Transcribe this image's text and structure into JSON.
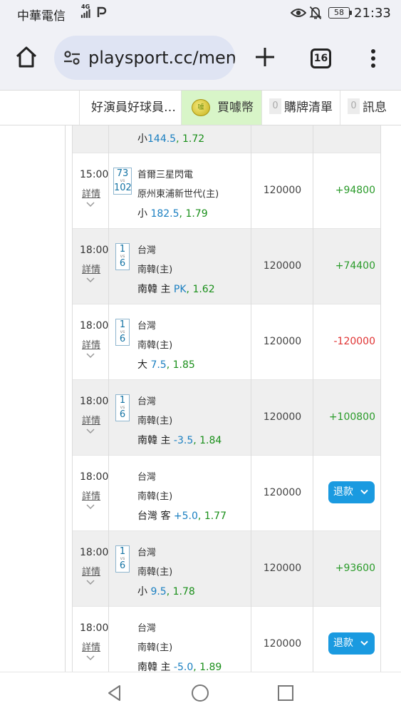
{
  "status_bar": {
    "carrier": "中華電信",
    "network": "4G",
    "battery": "58",
    "time": "21:33"
  },
  "browser": {
    "url": "playsport.cc/men",
    "tab_count": "16",
    "icons": [
      "home-icon",
      "site-info-icon",
      "new-tab-icon",
      "tabs-icon",
      "more-menu-icon"
    ]
  },
  "site_nav": {
    "player": "好演員好球員…",
    "coins": "買噱幣",
    "cart_count": "0",
    "cart": "購牌清單",
    "msg_count": "0",
    "msg": "訊息"
  },
  "top_partial": {
    "pick": "小",
    "line": "144.5",
    "odds": "1.72"
  },
  "bets": [
    {
      "time": "15:00",
      "detail": "詳情",
      "score_away": "73",
      "vs": "vs",
      "score_home": "102",
      "team1": "首爾三星閃電",
      "team2": "原州東浦新世代(主)",
      "pick": "小",
      "line": "182.5",
      "odds": "1.79",
      "amount": "120000",
      "result": "+94800",
      "result_type": "win"
    },
    {
      "time": "18:00",
      "detail": "詳情",
      "score_away": "1",
      "vs": "vs",
      "score_home": "6",
      "team1": "台灣",
      "team2": "南韓(主)",
      "pick": "南韓 主",
      "line": "PK",
      "odds": "1.62",
      "amount": "120000",
      "result": "+74400",
      "result_type": "win"
    },
    {
      "time": "18:00",
      "detail": "詳情",
      "score_away": "1",
      "vs": "vs",
      "score_home": "6",
      "team1": "台灣",
      "team2": "南韓(主)",
      "pick": "大",
      "line": "7.5",
      "odds": "1.85",
      "amount": "120000",
      "result": "-120000",
      "result_type": "lose"
    },
    {
      "time": "18:00",
      "detail": "詳情",
      "score_away": "1",
      "vs": "vs",
      "score_home": "6",
      "team1": "台灣",
      "team2": "南韓(主)",
      "pick": "南韓 主",
      "line": "-3.5",
      "odds": "1.84",
      "amount": "120000",
      "result": "+100800",
      "result_type": "win"
    },
    {
      "time": "18:00",
      "detail": "詳情",
      "team1": "台灣",
      "team2": "南韓(主)",
      "pick": "台灣 客",
      "line": "+5.0",
      "odds": "1.77",
      "amount": "120000",
      "refund": "退款"
    },
    {
      "time": "18:00",
      "detail": "詳情",
      "score_away": "1",
      "vs": "vs",
      "score_home": "6",
      "team1": "台灣",
      "team2": "南韓(主)",
      "pick": "小",
      "line": "9.5",
      "odds": "1.78",
      "amount": "120000",
      "result": "+93600",
      "result_type": "win"
    },
    {
      "time": "18:00",
      "detail": "詳情",
      "team1": "台灣",
      "team2": "南韓(主)",
      "pick": "南韓 主",
      "line": "-5.0",
      "odds": "1.89",
      "amount": "120000",
      "refund": "退款"
    }
  ],
  "colors": {
    "win": "#2a9b2a",
    "lose": "#e03333",
    "line": "#1a7fc1",
    "refund_button": "#1a9ae0",
    "coins_bg": "#d8f5c8"
  },
  "nav_bar": {
    "icons": [
      "back-icon",
      "home-circle-icon",
      "recents-icon"
    ]
  }
}
